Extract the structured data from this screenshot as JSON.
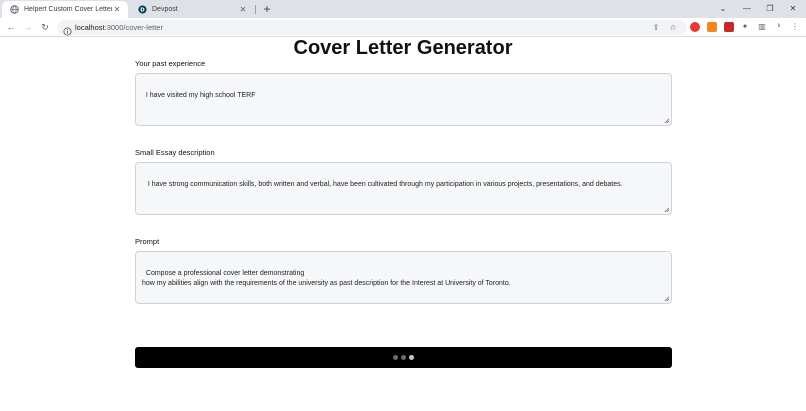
{
  "browser": {
    "tabs": [
      {
        "title": "Helpert Custom Cover Letter",
        "active": true
      },
      {
        "title": "Devpost",
        "active": false
      }
    ],
    "url_host": "localhost",
    "url_path": ":3000/cover-letter"
  },
  "page": {
    "title": "Cover Letter Generator",
    "fields": [
      {
        "label": "Your past experience",
        "value": "I have visited my high school TERF"
      },
      {
        "label": "Small Essay description",
        "value": " I have strong communication skills, both written and verbal, have been cultivated through my participation in various projects, presentations, and debates."
      },
      {
        "label": "Prompt",
        "value": "Compose a professional cover letter demonstrating\nhow my abilities align with the requirements of the university as past description for the Interest at University of Toronto."
      }
    ],
    "loading_dots": 3
  },
  "colors": {
    "button_bg": "#000000",
    "dot_dim": "#6b6b6b",
    "dot_bright": "#c8c8c8"
  }
}
